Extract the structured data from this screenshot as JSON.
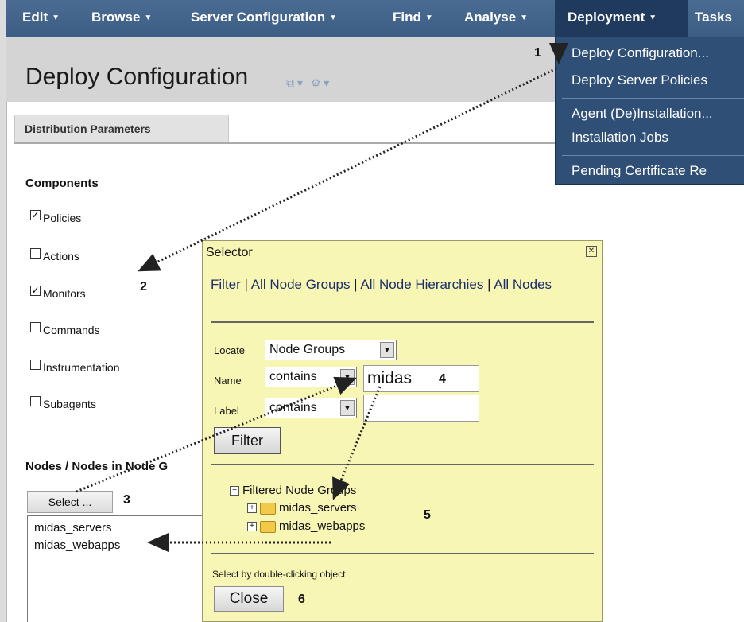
{
  "menubar": {
    "items": [
      {
        "label": "Edit"
      },
      {
        "label": "Browse"
      },
      {
        "label": "Server Configuration"
      },
      {
        "label": "Find"
      },
      {
        "label": "Analyse"
      },
      {
        "label": "Deployment"
      },
      {
        "label": "Tasks"
      }
    ]
  },
  "dropdown": {
    "items": [
      "Deploy Configuration...",
      "Deploy Server Policies",
      "Agent (De)Installation...",
      "Installation Jobs",
      "Pending Certificate Re"
    ]
  },
  "page": {
    "title": "Deploy Configuration",
    "tab": "Distribution Parameters"
  },
  "components": {
    "heading": "Components",
    "items": [
      {
        "label": "Policies",
        "checked": true
      },
      {
        "label": "Actions",
        "checked": false
      },
      {
        "label": "Monitors",
        "checked": true
      },
      {
        "label": "Commands",
        "checked": false
      },
      {
        "label": "Instrumentation",
        "checked": false
      },
      {
        "label": "Subagents",
        "checked": false
      }
    ]
  },
  "nodes": {
    "heading": "Nodes / Nodes in Node G",
    "select_label": "Select ...",
    "list": [
      "midas_servers",
      "midas_webapps"
    ]
  },
  "selector": {
    "title": "Selector",
    "links": [
      "Filter",
      "All Node Groups",
      "All Node Hierarchies",
      "All Nodes"
    ],
    "locate_label": "Locate",
    "locate_value": "Node Groups",
    "name_label": "Name",
    "name_operator": "contains",
    "name_value": "midas",
    "label_label": "Label",
    "label_operator": "contains",
    "label_value": "",
    "filter_button": "Filter",
    "tree_root": "Filtered Node Groups",
    "tree_items": [
      "midas_servers",
      "midas_webapps"
    ],
    "hint": "Select by double-clicking object",
    "close_button": "Close"
  },
  "annotations": [
    "1",
    "2",
    "3",
    "4",
    "5",
    "6"
  ],
  "colors": {
    "menubar": "#3f6089",
    "dropdown": "#2f4f77",
    "selector_bg": "#f8f6b4"
  }
}
